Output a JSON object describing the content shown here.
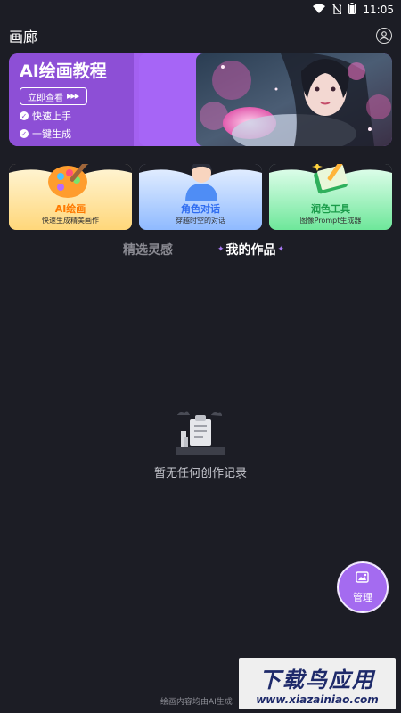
{
  "status_bar": {
    "time": "11:05"
  },
  "header": {
    "title": "画廊",
    "profile_icon": "user-circle-icon"
  },
  "banner": {
    "title": "AI绘画教程",
    "cta_label": "立即查看",
    "points": [
      "快速上手",
      "一键生成"
    ],
    "accent_color": "#8d4fd6"
  },
  "features": [
    {
      "title": "AI绘画",
      "subtitle": "快速生成精美画作",
      "title_color": "#ff7a00",
      "icon": "palette-icon"
    },
    {
      "title": "角色对话",
      "subtitle": "穿越时空的对话",
      "title_color": "#2f6cf0",
      "icon": "avatar-icon"
    },
    {
      "title": "润色工具",
      "subtitle": "图像Prompt生成器",
      "title_color": "#1a9c4a",
      "icon": "book-icon"
    }
  ],
  "tabs": {
    "inspire": "精选灵感",
    "mine": "我的作品",
    "active": "mine"
  },
  "empty_state": {
    "text": "暂无任何创作记录"
  },
  "manage_button": {
    "label": "管理",
    "icon": "image-edit-icon",
    "color": "#a46bf0"
  },
  "footer": {
    "note": "绘画内容均由AI生成"
  },
  "watermark": {
    "main": "下载鸟应用",
    "sub": "www.xiazainiao.com"
  }
}
